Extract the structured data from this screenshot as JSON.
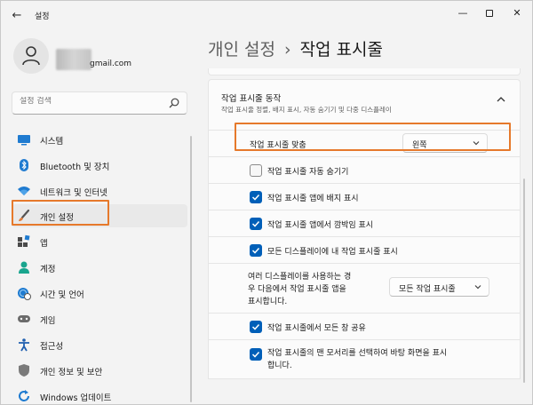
{
  "window": {
    "title": "설정"
  },
  "account": {
    "email": "gmail.com"
  },
  "search": {
    "placeholder": "설정 검색"
  },
  "sidebar": {
    "items": [
      {
        "label": "시스템",
        "icon": "monitor-icon"
      },
      {
        "label": "Bluetooth 및 장치",
        "icon": "bluetooth-icon"
      },
      {
        "label": "네트워크 및 인터넷",
        "icon": "wifi-icon"
      },
      {
        "label": "개인 설정",
        "icon": "brush-icon",
        "selected": true
      },
      {
        "label": "앱",
        "icon": "apps-icon"
      },
      {
        "label": "계정",
        "icon": "person-icon"
      },
      {
        "label": "시간 및 언어",
        "icon": "globe-clock-icon"
      },
      {
        "label": "게임",
        "icon": "gamepad-icon"
      },
      {
        "label": "접근성",
        "icon": "accessibility-icon"
      },
      {
        "label": "개인 정보 및 보안",
        "icon": "shield-icon"
      },
      {
        "label": "Windows 업데이트",
        "icon": "update-icon"
      }
    ]
  },
  "breadcrumb": {
    "parent": "개인 설정",
    "separator": "›",
    "current": "작업 표시줄"
  },
  "behaviors": {
    "title": "작업 표시줄 동작",
    "subtitle": "작업 표시줄 정렬, 배지 표시, 자동 숨기기 및 다중 디스플레이",
    "alignment": {
      "label": "작업 표시줄 맞춤",
      "value": "왼쪽"
    },
    "options": [
      {
        "label": "작업 표시줄 자동 숨기기",
        "checked": false
      },
      {
        "label": "작업 표시줄 앱에 배지 표시",
        "checked": true
      },
      {
        "label": "작업 표시줄 앱에서 깜박임 표시",
        "checked": true
      },
      {
        "label": "모든 디스플레이에 내 작업 표시줄 표시",
        "checked": true
      }
    ],
    "multi_display": {
      "label_line1": "여러 디스플레이를 사용하는 경",
      "label_line2": "우 다음에서 작업 표시줄 앱을",
      "label_line3": "표시합니다.",
      "value": "모든 작업 표시줄"
    },
    "options_after": [
      {
        "label": "작업 표시줄에서 모든 창 공유",
        "checked": true
      },
      {
        "label_line1": "작업 표시줄의 맨 모서리를 선택하여 바탕 화면을 표시",
        "label_line2": "합니다.",
        "checked": true
      }
    ]
  },
  "colors": {
    "accent": "#005fb8",
    "highlight": "#e6792b"
  }
}
